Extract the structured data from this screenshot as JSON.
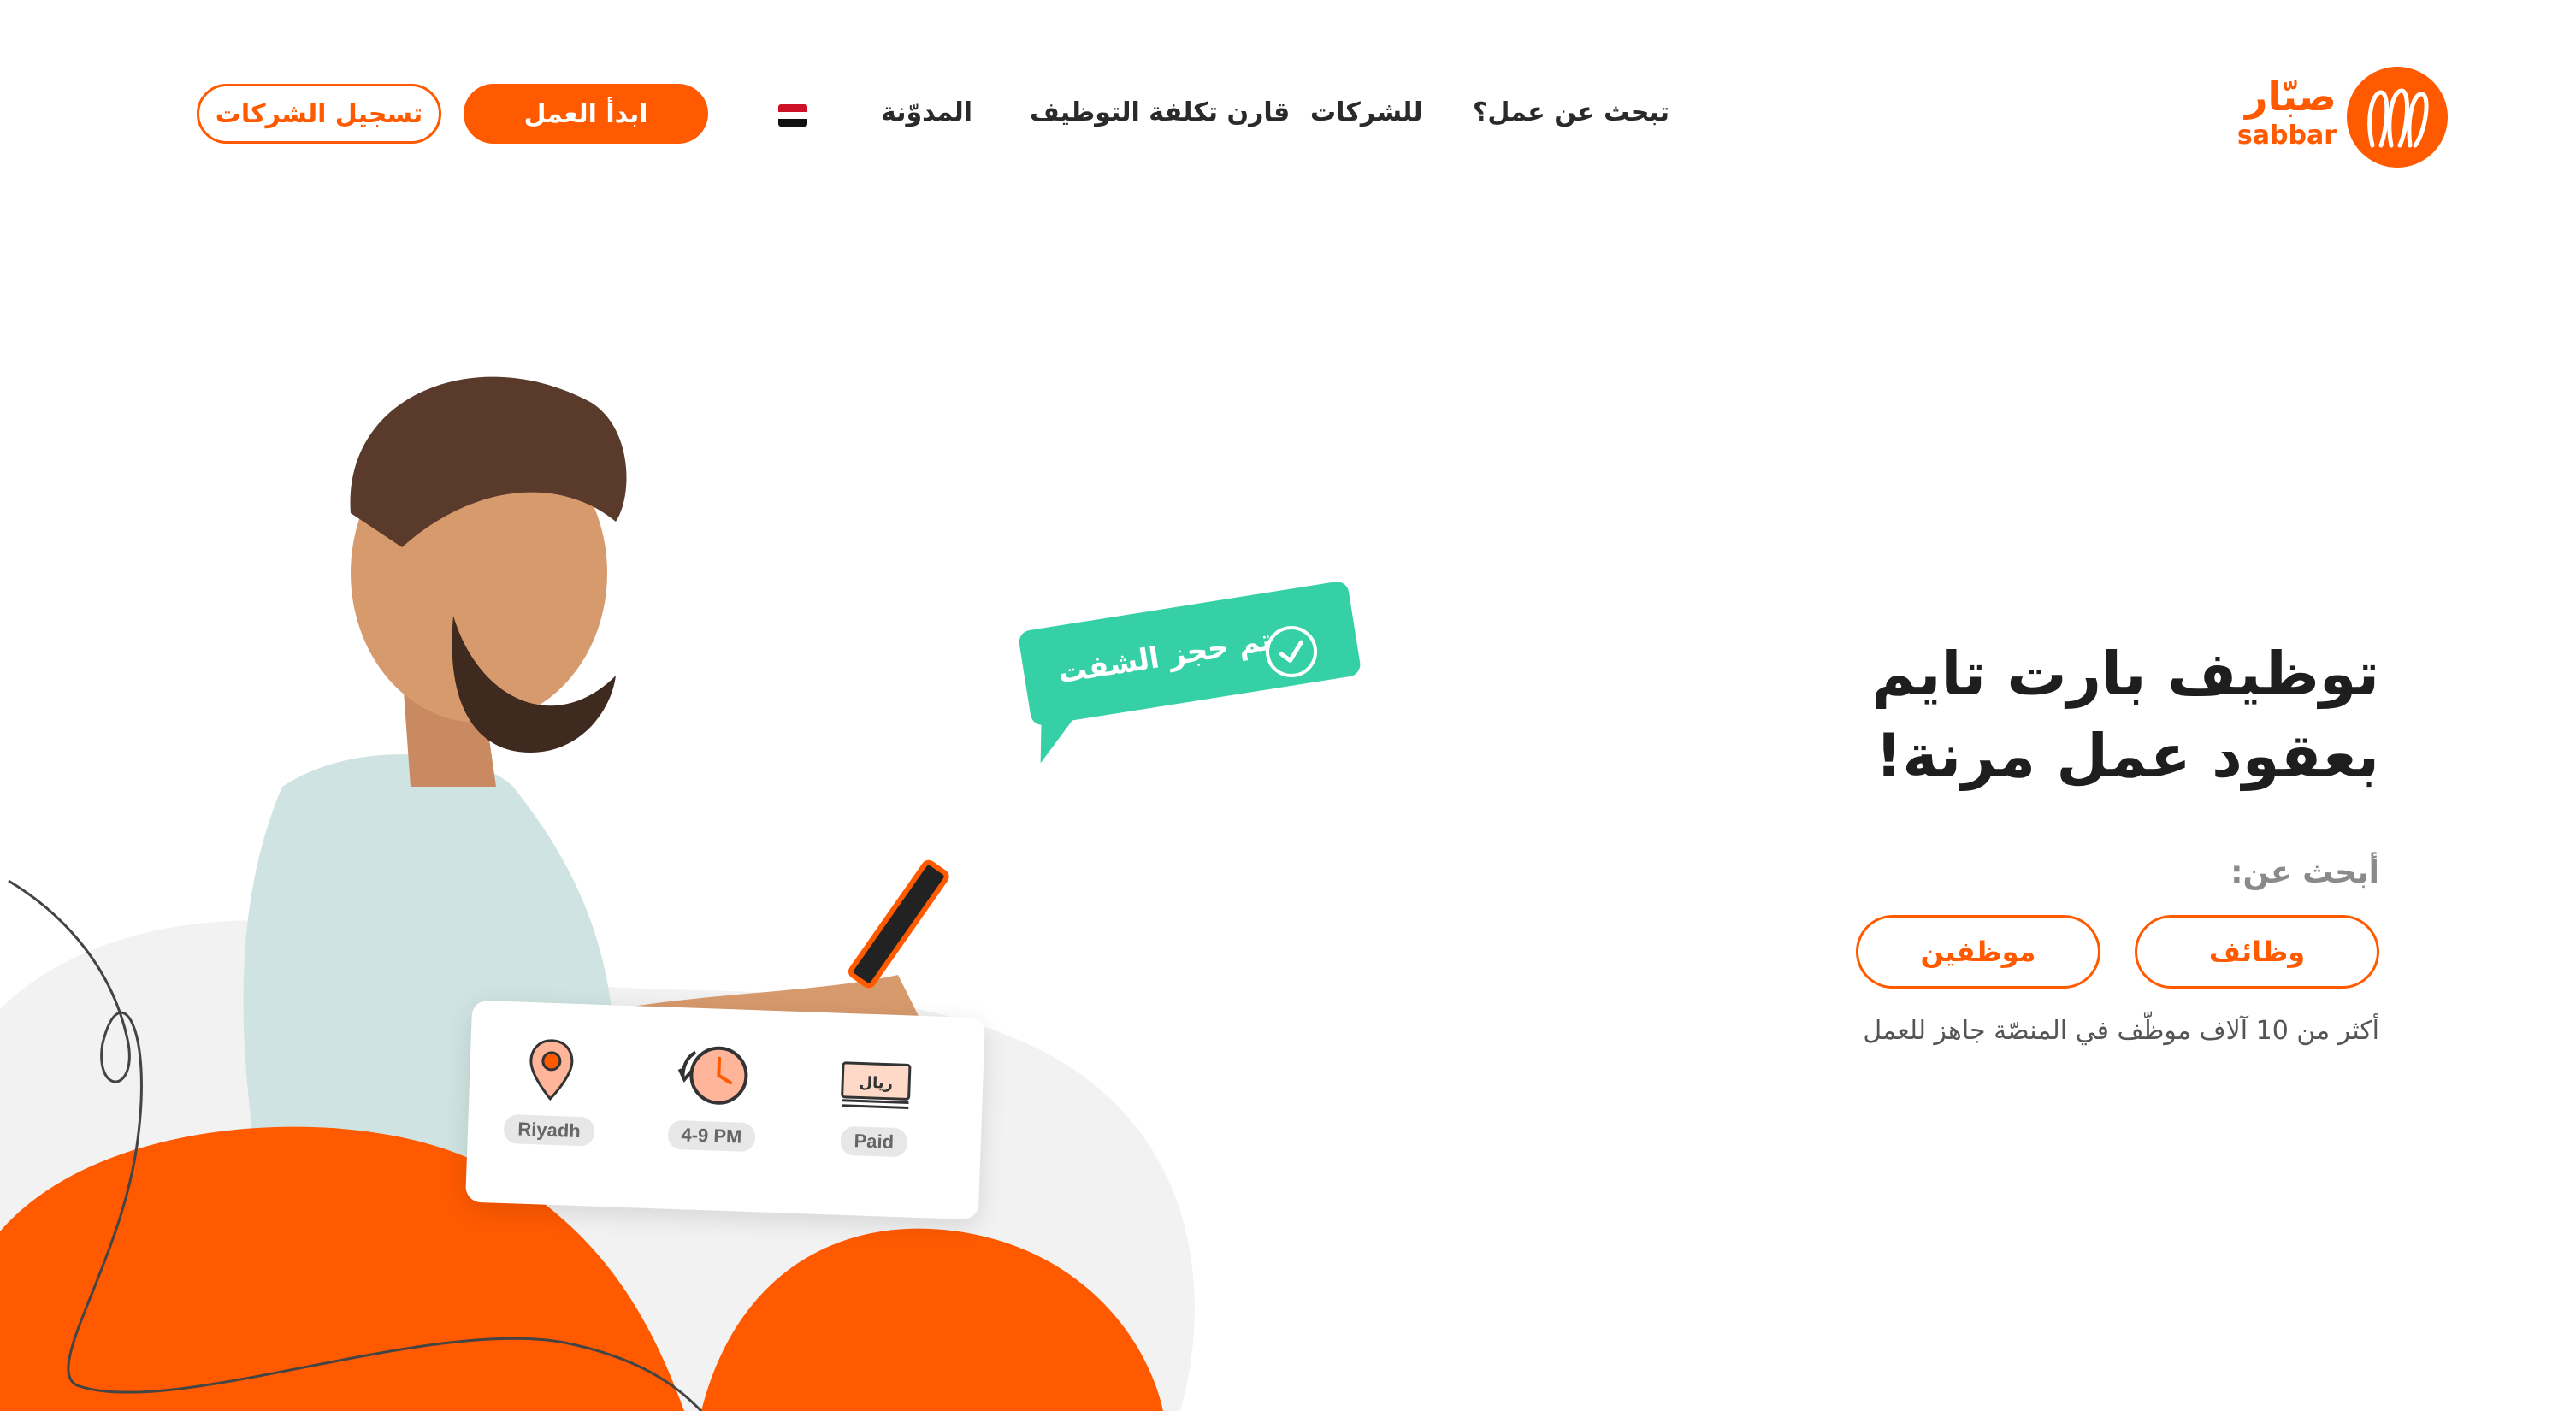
{
  "brand": {
    "name_ar": "صبّار",
    "name_en": "sabbar",
    "accent_color": "#ff5a00"
  },
  "nav": {
    "items": [
      {
        "label": "تبحث عن عمل؟"
      },
      {
        "label": "للشركات"
      },
      {
        "label": "قارن تكلفة التوظيف"
      },
      {
        "label": "المدوّنة"
      }
    ],
    "language_flag_icon": "egypt-flag-icon",
    "start_work_label": "ابدأ العمل",
    "company_signup_label": "تسجيل الشركات"
  },
  "hero": {
    "title_line1": "توظيف بارت تايم",
    "title_line2": "بعقود عمل مرنة!",
    "search_label": "أبحث عن:",
    "jobs_button": "وظائف",
    "employees_button": "موظفين",
    "sub_note": "أكثر من 10 آلاف موظّف في المنصّة جاهز للعمل"
  },
  "illustration": {
    "bubble_text": "تم حجز الشفت",
    "bubble_color": "#35d0a6",
    "card": [
      {
        "icon": "money-icon",
        "label": "Paid",
        "money_text": "ريال"
      },
      {
        "icon": "clock-icon",
        "label": "4-9 PM"
      },
      {
        "icon": "location-pin-icon",
        "label": "Riyadh"
      }
    ]
  }
}
